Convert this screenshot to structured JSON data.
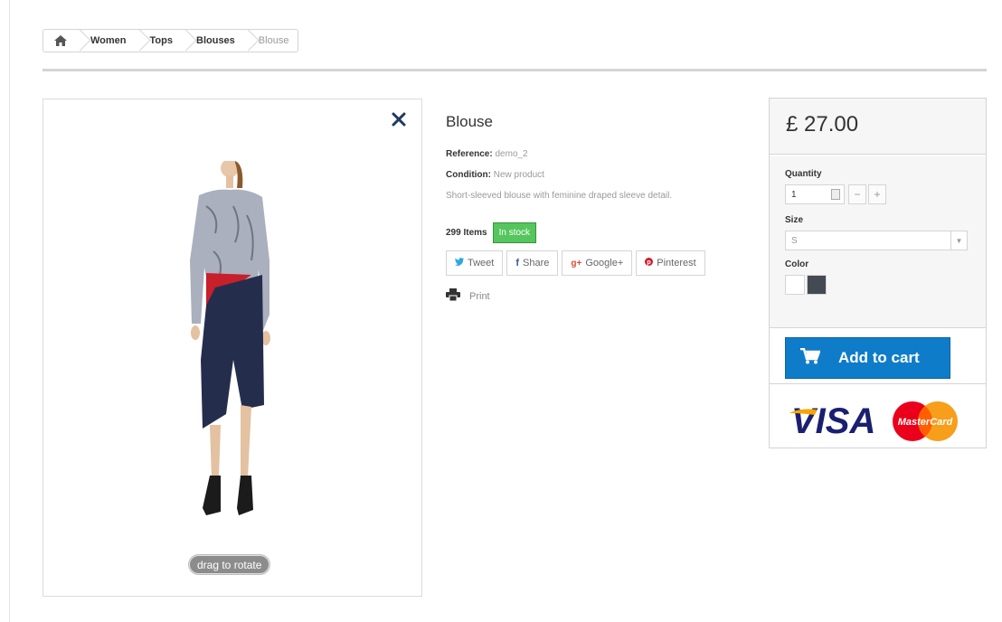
{
  "breadcrumb": {
    "items": [
      "Women",
      "Tops",
      "Blouses"
    ],
    "current": "Blouse"
  },
  "product": {
    "title": "Blouse",
    "reference_label": "Reference:",
    "reference_value": "demo_2",
    "condition_label": "Condition:",
    "condition_value": "New product",
    "description": "Short-sleeved blouse with feminine draped sleeve detail.",
    "quantity_available": "299 Items",
    "stock_status": "In stock",
    "image_hint": "drag to rotate"
  },
  "share": {
    "tweet": "Tweet",
    "share": "Share",
    "google": "Google+",
    "pinterest": "Pinterest"
  },
  "print_label": "Print",
  "buy_box": {
    "price": "£ 27.00",
    "quantity_label": "Quantity",
    "quantity_value": "1",
    "size_label": "Size",
    "size_value": "S",
    "color_label": "Color",
    "colors": [
      "#ffffff",
      "#434a54"
    ],
    "add_to_cart": "Add to cart",
    "payment_visa": "VISA",
    "payment_mastercard": "MasterCard"
  },
  "icons": [
    "home-icon",
    "close-icon",
    "twitter-icon",
    "facebook-icon",
    "google-plus-icon",
    "pinterest-icon",
    "print-icon",
    "cart-icon"
  ]
}
